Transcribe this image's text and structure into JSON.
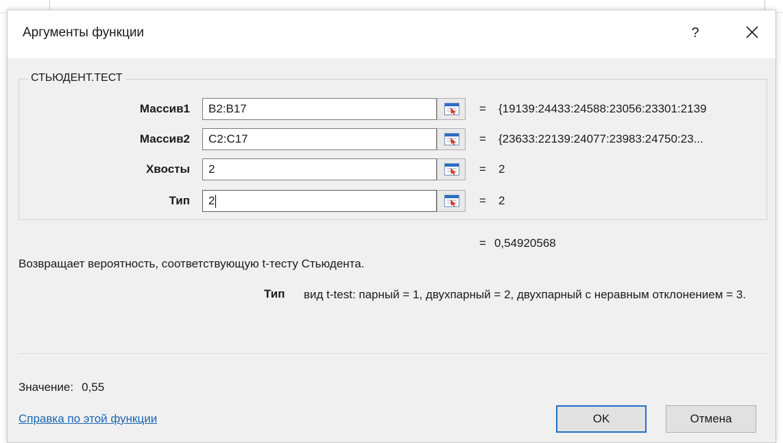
{
  "dialog": {
    "title": "Аргументы функции",
    "help_glyph": "?",
    "function_name": "СТЬЮДЕНТ.ТЕСТ"
  },
  "arguments": [
    {
      "label": "Массив1",
      "value": "B2:B17",
      "result": "{19139:24433:24588:23056:23301:2139"
    },
    {
      "label": "Массив2",
      "value": "C2:C17",
      "result": "{23633:22139:24077:23983:24750:23..."
    },
    {
      "label": "Хвосты",
      "value": "2",
      "result": "2"
    },
    {
      "label": "Тип",
      "value": "2",
      "result": "2"
    }
  ],
  "equals": "=",
  "formula_result": "0,54920568",
  "description": "Возвращает вероятность, соответствующую t-тесту Стьюдента.",
  "param_help": {
    "name": "Тип",
    "text": "вид t-test: парный = 1, двухпарный = 2, двухпарный с неравным отклонением = 3."
  },
  "value_row": {
    "label": "Значение:",
    "value": "0,55"
  },
  "help_link": "Справка по этой функции",
  "buttons": {
    "ok": "OK",
    "cancel": "Отмена"
  },
  "colors": {
    "dialog_bg": "#f0f0f0",
    "link": "#1a66b3",
    "ok_border": "#1a73c8",
    "ref_button_red": "#d9342b",
    "ref_button_blue": "#2b6cc4"
  },
  "icons": {
    "close": "close-icon",
    "ref_collapse": "collapse-dialog-icon"
  }
}
